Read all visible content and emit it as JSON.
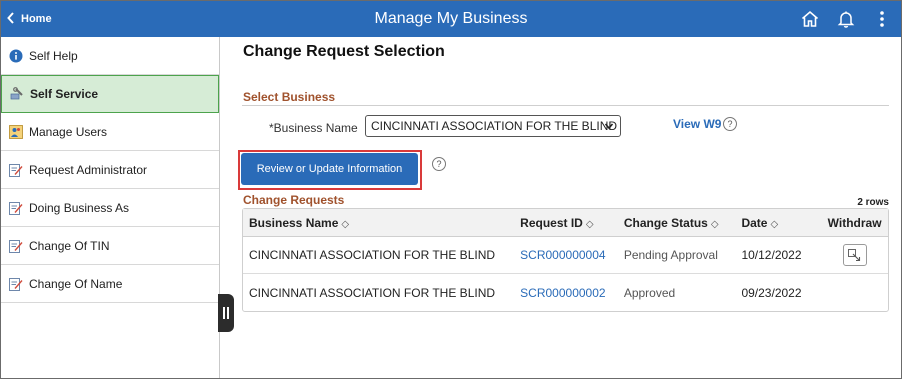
{
  "header": {
    "home_label": "Home",
    "title": "Manage My Business",
    "icons": [
      "home-icon",
      "bell-icon",
      "more-vertical-icon"
    ]
  },
  "sidebar": {
    "items": [
      {
        "label": "Self Help",
        "icon": "info-icon",
        "active": false
      },
      {
        "label": "Self Service",
        "icon": "tools-icon",
        "active": true
      },
      {
        "label": "Manage Users",
        "icon": "users-icon",
        "active": false
      },
      {
        "label": "Request Administrator",
        "icon": "edit-icon",
        "active": false
      },
      {
        "label": "Doing Business As",
        "icon": "edit-icon",
        "active": false
      },
      {
        "label": "Change Of TIN",
        "icon": "edit-icon",
        "active": false
      },
      {
        "label": "Change Of Name",
        "icon": "edit-icon",
        "active": false
      }
    ]
  },
  "main": {
    "page_title": "Change Request Selection",
    "select_business": {
      "section_title": "Select Business",
      "label": "*Business Name",
      "selected_value": "CINCINNATI ASSOCIATION FOR THE BLIND",
      "view_w9": "View W9",
      "help": "?"
    },
    "review_button": "Review or Update Information",
    "review_help": "?",
    "change_requests": {
      "section_title": "Change Requests",
      "rows_count": "2 rows",
      "columns": [
        "Business Name",
        "Request ID",
        "Change Status",
        "Date",
        "Withdraw"
      ],
      "sort_glyph": "◇",
      "rows": [
        {
          "business_name": "CINCINNATI ASSOCIATION FOR THE BLIND",
          "request_id": "SCR000000004",
          "status": "Pending Approval",
          "date": "10/12/2022",
          "withdraw": true
        },
        {
          "business_name": "CINCINNATI ASSOCIATION FOR THE BLIND",
          "request_id": "SCR000000002",
          "status": "Approved",
          "date": "09/23/2022",
          "withdraw": false
        }
      ]
    }
  },
  "colors": {
    "header_bg": "#2a6bb8",
    "active_bg": "#d6ecd6",
    "active_border": "#4ca34c",
    "section_title": "#a0522d",
    "highlight": "#d93a3a",
    "link": "#2a6bb8"
  }
}
